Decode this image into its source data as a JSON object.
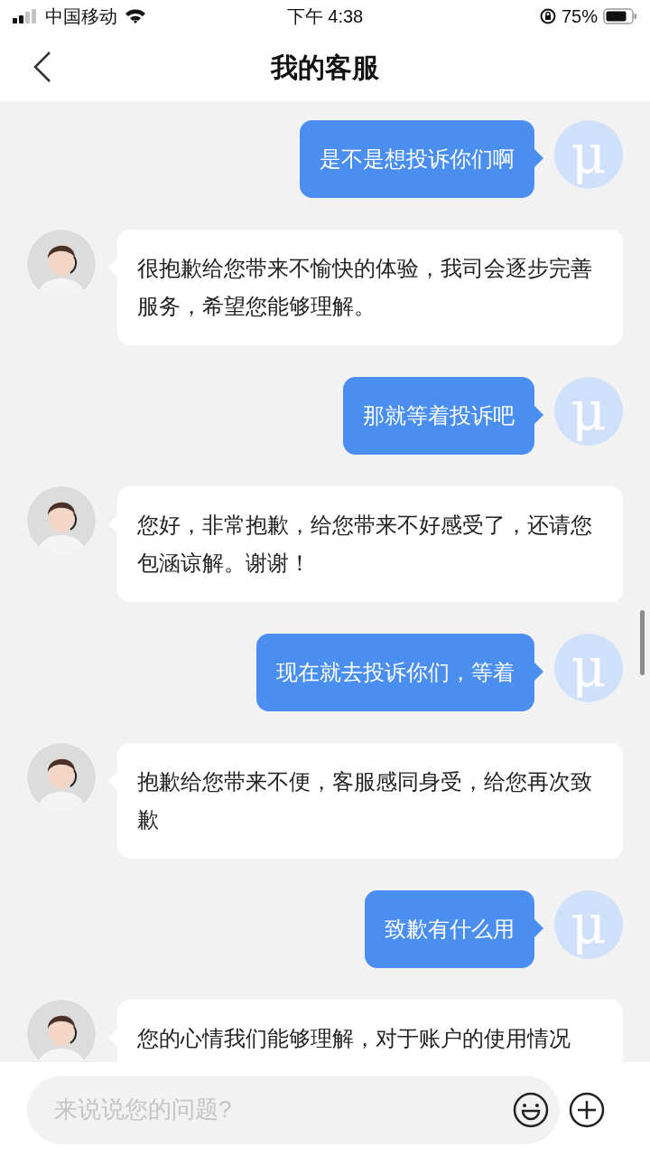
{
  "status_bar": {
    "carrier": "中国移动",
    "time": "下午 4:38",
    "battery": "75%"
  },
  "header": {
    "title": "我的客服"
  },
  "messages": [
    {
      "kind": "user",
      "text": "是不是想投诉你们啊",
      "avatar_text": "μ"
    },
    {
      "kind": "agent",
      "text": "很抱歉给您带来不愉快的体验，我司会逐步完善服务，希望您能够理解。"
    },
    {
      "kind": "user",
      "text": "那就等着投诉吧",
      "avatar_text": "μ"
    },
    {
      "kind": "agent",
      "text": "您好，非常抱歉，给您带来不好感受了，还请您包涵谅解。谢谢！"
    },
    {
      "kind": "user",
      "text": "现在就去投诉你们，等着",
      "avatar_text": "μ"
    },
    {
      "kind": "agent",
      "text": "抱歉给您带来不便，客服感同身受，给您再次致歉"
    },
    {
      "kind": "user",
      "text": "致歉有什么用",
      "avatar_text": "μ"
    },
    {
      "kind": "agent",
      "text": "您的心情我们能够理解，对于账户的使用情况"
    }
  ],
  "input": {
    "placeholder": "来说说您的问题?"
  }
}
